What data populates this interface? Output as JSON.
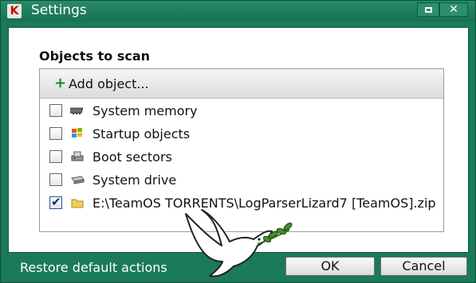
{
  "window": {
    "title": "Settings",
    "app_icon_glyph": "K",
    "maximize_icon": "maximize-icon",
    "close_glyph": "✕"
  },
  "section": {
    "title": "Objects to scan"
  },
  "add_object": {
    "label": "Add object...",
    "icon": "plus-icon"
  },
  "objects": [
    {
      "label": "System memory",
      "checked": false,
      "icon": "memory-chip-icon"
    },
    {
      "label": "Startup objects",
      "checked": false,
      "icon": "windows-logo-icon"
    },
    {
      "label": "Boot sectors",
      "checked": false,
      "icon": "disk-drive-icon"
    },
    {
      "label": "System drive",
      "checked": false,
      "icon": "hard-drive-icon"
    },
    {
      "label": "E:\\TeamOS TORRENTS\\LogParserLizard7 [TeamOS].zip",
      "checked": true,
      "icon": "folder-icon"
    }
  ],
  "footer": {
    "restore_label": "Restore default actions",
    "ok_label": "OK",
    "cancel_label": "Cancel"
  },
  "colors": {
    "frame": "#1b7a58",
    "accent_plus": "#188a3a",
    "check": "#0a2a80"
  }
}
